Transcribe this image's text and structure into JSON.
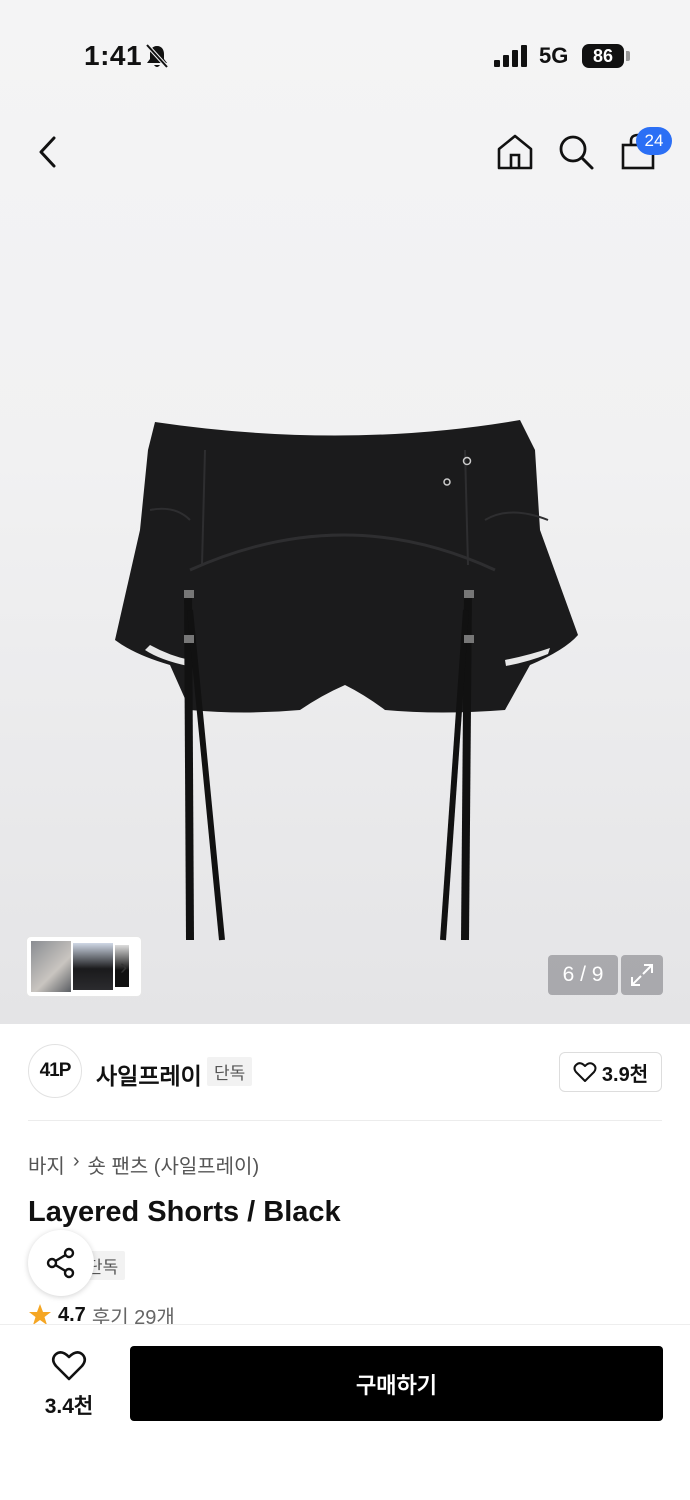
{
  "status_bar": {
    "time": "1:41",
    "network": "5G",
    "battery": "86"
  },
  "nav": {
    "cart_count": "24",
    "icons": [
      "chevron-left-icon",
      "home-icon",
      "search-icon",
      "shopping-bag-icon"
    ]
  },
  "gallery": {
    "pager": "6 / 9"
  },
  "brand": {
    "logo_text": "41P",
    "name": "사일프레이",
    "tag": "단독",
    "like_count": "3.9천"
  },
  "breadcrumb": [
    "바지",
    "숏 팬츠 (사일프레이)"
  ],
  "product": {
    "title": "Layered Shorts / Black",
    "tag": "단독",
    "rating": "4.7",
    "reviews": "후기 29개"
  },
  "bottom": {
    "wish_count": "3.4천",
    "buy_label": "구매하기"
  },
  "colors": {
    "accent_badge": "#2b6ff5",
    "buy_button": "#000000",
    "star": "#f5a623"
  }
}
